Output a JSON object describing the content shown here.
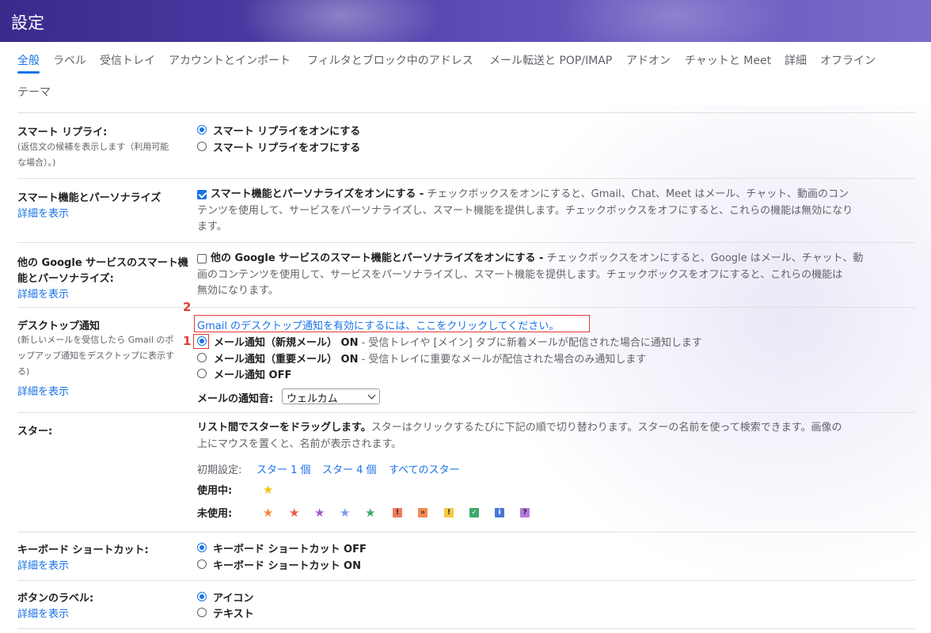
{
  "header": {
    "title": "設定"
  },
  "tabs": [
    {
      "label": "全般"
    },
    {
      "label": "ラベル"
    },
    {
      "label": "受信トレイ"
    },
    {
      "label": "アカウントとインポート"
    },
    {
      "label": "フィルタとブロック中のアドレス"
    },
    {
      "label": "メール転送と POP/IMAP"
    },
    {
      "label": "アドオン"
    },
    {
      "label": "チャットと Meet"
    },
    {
      "label": "詳細"
    },
    {
      "label": "オフライン"
    },
    {
      "label": "テーマ"
    }
  ],
  "smart_reply": {
    "label": "スマート リプライ:",
    "desc1": "(返信文の候補を表示します（利用可能",
    "desc2": "な場合）。)",
    "on": "スマート リプライをオンにする",
    "off": "スマート リプライをオフにする"
  },
  "smart_features": {
    "label": "スマート機能とパーソナライズ",
    "details": "詳細を表示",
    "checkbox_label": "スマート機能とパーソナライズをオンにする -",
    "line1": " チェックボックスをオンにすると、Gmail、Chat、Meet はメール、チャット、動画のコン",
    "line2": "テンツを使用して、サービスをパーソナライズし、スマート機能を提供します。チェックボックスをオフにすると、これらの機能は無効になり",
    "line3": "ます。"
  },
  "google_features": {
    "label1": "他の Google サービスのスマート機",
    "label2": "能とパーソナライズ:",
    "details": "詳細を表示",
    "checkbox_label": "他の Google サービスのスマート機能とパーソナライズをオンにする -",
    "line1": " チェックボックスをオンにすると、Google はメール、チャット、動",
    "line2": "画のコンテンツを使用して、サービスをパーソナライズし、スマート機能を提供します。チェックボックスをオフにすると、これらの機能は",
    "line3": "無効になります。"
  },
  "desktop": {
    "label": "デスクトップ通知",
    "desc1": "(新しいメールを受信したら Gmail のポ",
    "desc2": "ップアップ通知をデスクトップに表示す",
    "desc3": "る)",
    "details": "詳細を表示",
    "enable_link": "Gmail のデスクトップ通知を有効にするには、ここをクリックしてください。",
    "opt1_bold": "メール通知（新規メール） ON",
    "opt1_rest": " - 受信トレイや [メイン] タブに新着メールが配信された場合に通知します",
    "opt2_bold": "メール通知（重要メール） ON",
    "opt2_rest": " - 受信トレイに重要なメールが配信された場合のみ通知します",
    "opt3_bold": "メール通知 OFF",
    "sound_label": "メールの通知音:",
    "sound_value": "ウェルカム",
    "marker1": "1",
    "marker2": "2"
  },
  "stars": {
    "label": "スター:",
    "line1_bold": "リスト間でスターをドラッグします。",
    "line1_rest": "スターはクリックするたびに下記の順で切り替わります。スターの名前を使って検索できます。画像の",
    "line2": "上にマウスを置くと、名前が表示されます。",
    "presets_label": "初期設定:",
    "preset1": "スター 1 個",
    "preset4": "スター 4 個",
    "preset_all": "すべてのスター",
    "in_use": "使用中:",
    "not_in_use": "未使用:",
    "colors": {
      "yellow": "#f4c20d",
      "orange": "#f5863b",
      "red": "#ea5a4b",
      "purple": "#9b59d0",
      "blue": "#7a9cf0",
      "green": "#3ca86b"
    },
    "glyphs": {
      "star": "★",
      "excl": "!",
      "guillemet": "»",
      "check": "✓",
      "info": "i",
      "question": "?"
    }
  },
  "keyboard": {
    "label": "キーボード ショートカット:",
    "details": "詳細を表示",
    "off": "キーボード ショートカット OFF",
    "on": "キーボード ショートカット ON"
  },
  "button_labels": {
    "label": "ボタンのラベル:",
    "details": "詳細を表示",
    "icons": "アイコン",
    "text": "テキスト"
  }
}
